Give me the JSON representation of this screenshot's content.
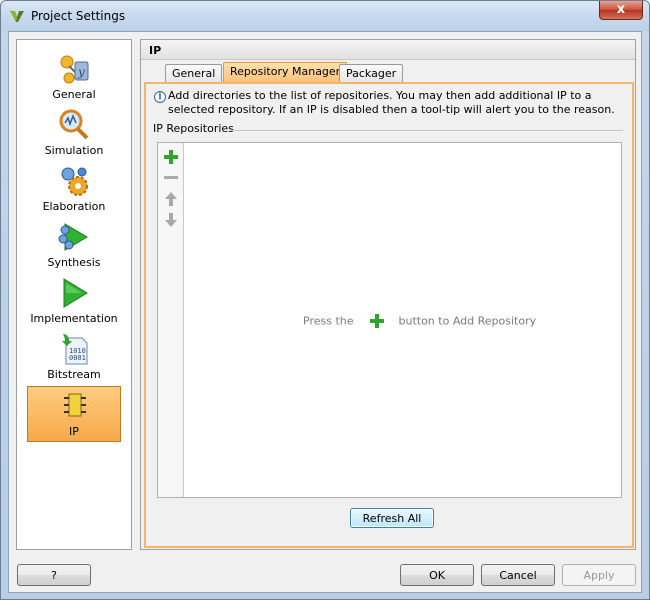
{
  "window": {
    "title": "Project Settings",
    "close_label": "x"
  },
  "nav": {
    "items": [
      {
        "label": "General",
        "icon": "general-settings-icon"
      },
      {
        "label": "Simulation",
        "icon": "simulation-magnifier-icon"
      },
      {
        "label": "Elaboration",
        "icon": "elaboration-gears-icon"
      },
      {
        "label": "Synthesis",
        "icon": "synthesis-icon"
      },
      {
        "label": "Implementation",
        "icon": "implementation-play-icon"
      },
      {
        "label": "Bitstream",
        "icon": "bitstream-file-icon"
      },
      {
        "label": "IP",
        "icon": "ip-chip-icon"
      }
    ],
    "selected": "IP"
  },
  "content": {
    "header": "IP",
    "tabs": [
      {
        "label": "General"
      },
      {
        "label": "Repository Manager"
      },
      {
        "label": "Packager"
      }
    ],
    "active_tab": "Repository Manager",
    "info_text": "Add directories to the list of repositories. You may then add additional IP to a selected repository. If an IP is disabled then a tool-tip will alert you to the reason.",
    "section_label": "IP Repositories",
    "empty_message_pre": "Press the",
    "empty_message_post": "button to Add Repository",
    "refresh_label": "Refresh All"
  },
  "footer": {
    "help_label": "?",
    "ok_label": "OK",
    "cancel_label": "Cancel",
    "apply_label": "Apply"
  },
  "colors": {
    "accent_orange": "#f7a84a",
    "add_green": "#2fa52f"
  }
}
